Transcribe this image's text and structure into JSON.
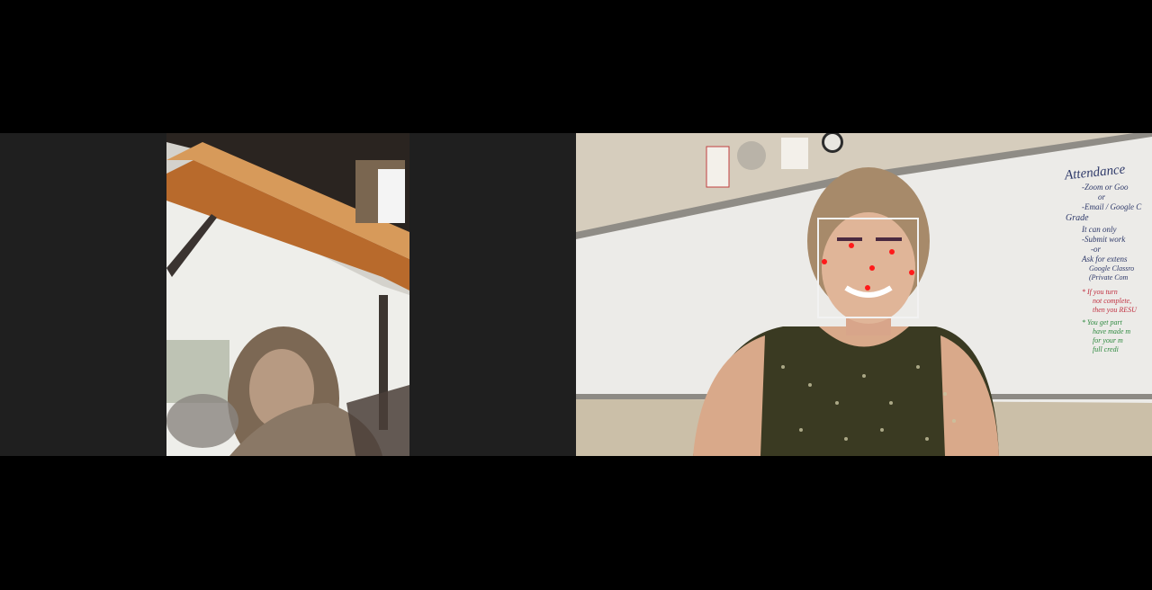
{
  "participants": [
    {
      "id": "left"
    },
    {
      "id": "right"
    }
  ],
  "whiteboard": {
    "title": "Attendance",
    "lines": [
      "-Zoom or Goo",
      "or",
      "-Email / Google C",
      "Grade",
      "It can only",
      "-Submit work",
      "-or",
      "Ask for extens",
      "Google Classro",
      "(Private Com"
    ],
    "red_lines": [
      "* If you turn",
      "not complete,",
      "then you RESU"
    ],
    "green_lines": [
      "* You get part",
      "have made m",
      "for your m",
      "full credi"
    ]
  },
  "face_detection": {
    "landmarks": [
      "left-eye",
      "right-eye",
      "nose",
      "mouth",
      "left-cheek",
      "right-cheek"
    ]
  },
  "colors": {
    "background": "#000000",
    "tile": "#1f1f1f",
    "detection_box": "#f2f2f2",
    "landmark": "#ff1a1a"
  }
}
